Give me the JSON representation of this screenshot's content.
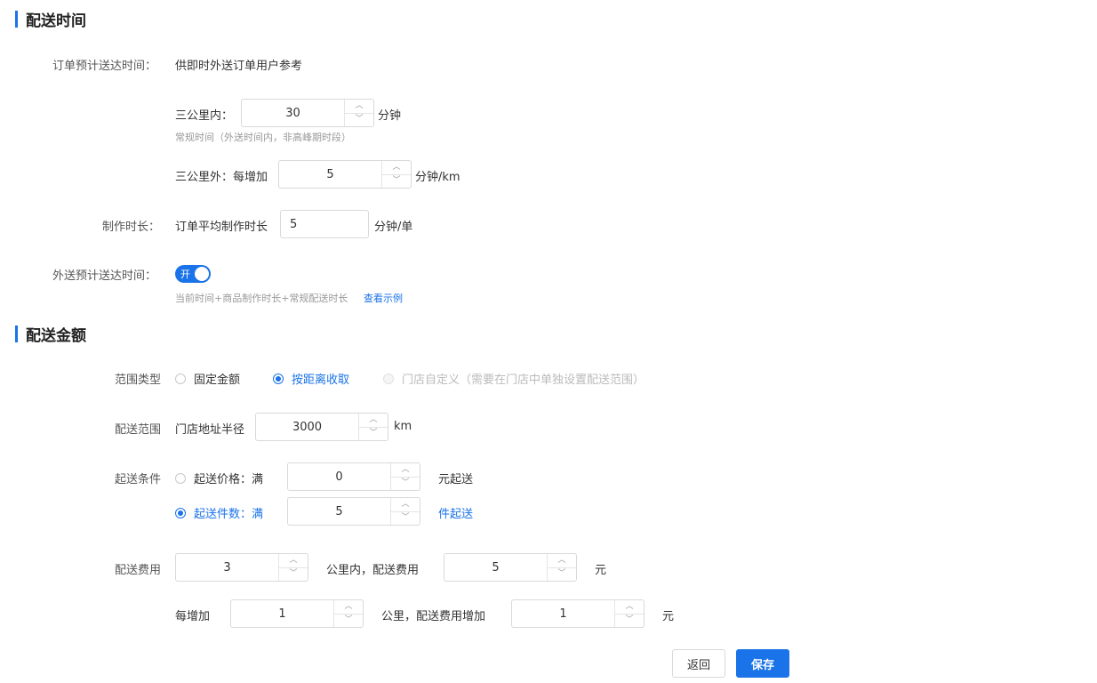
{
  "delivery_time": {
    "title": "配送时间",
    "order_eta_label": "订单预计送达时间：",
    "order_eta_desc": "供即时外送订单用户参考",
    "within3_label": "三公里内：",
    "within3_value": "30",
    "within3_unit": "分钟",
    "within3_hint": "常规时间（外送时间内，非高峰期时段）",
    "beyond3_label": "三公里外：每增加",
    "beyond3_value": "5",
    "beyond3_unit": "分钟/km",
    "prep_label": "制作时长：",
    "prep_desc": "订单平均制作时长",
    "prep_value": "5",
    "prep_unit": "分钟/单",
    "delivery_eta_label": "外送预计送达时间：",
    "switch_label": "开",
    "formula_hint": "当前时间+商品制作时长+常规配送时长",
    "example_link": "查看示例"
  },
  "delivery_fee": {
    "title": "配送金额",
    "range_type_label": "范围类型",
    "range_type_options": [
      "固定金额",
      "按距离收取",
      "门店自定义（需要在门店中单独设置配送范围）"
    ],
    "range_label": "配送范围",
    "range_desc": "门店地址半径",
    "range_value": "3000",
    "range_unit": "km",
    "condition_label": "起送条件",
    "cond_price_label": "起送价格：满",
    "cond_price_value": "0",
    "cond_price_unit": "元起送",
    "cond_count_label": "起送件数：满",
    "cond_count_value": "5",
    "cond_count_unit": "件起送",
    "fee_label": "配送费用",
    "fee_km_value": "3",
    "fee_mid_text": "公里内，配送费用",
    "fee_base_value": "5",
    "fee_unit": "元",
    "extra_prefix": "每增加",
    "extra_km_value": "1",
    "extra_mid_text": "公里，配送费用增加",
    "extra_fee_value": "1",
    "extra_unit": "元"
  },
  "actions": {
    "back": "返回",
    "save": "保存"
  }
}
